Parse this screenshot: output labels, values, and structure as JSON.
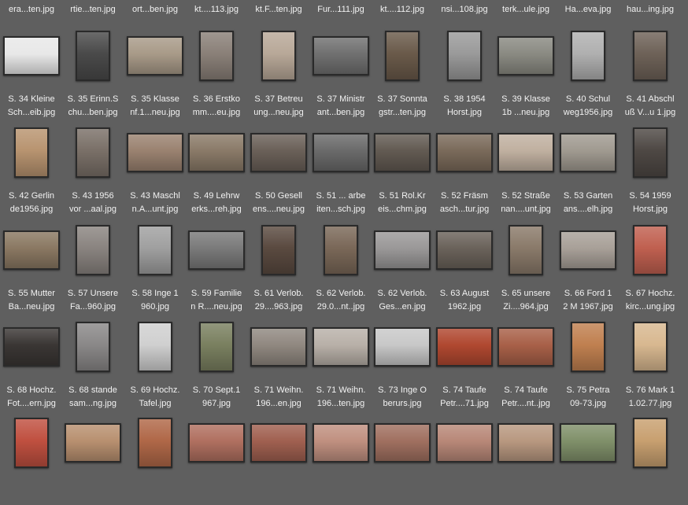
{
  "top_row": [
    "era...ten.jpg",
    "rtie...ten.jpg",
    "ort...ben.jpg",
    "kt....113.jpg",
    "kt.F...ten.jpg",
    "Fur...111.jpg",
    "kt....112.jpg",
    "nsi...108.jpg",
    "terk...ule.jpg",
    "Ha...eva.jpg",
    "hau...ing.jpg"
  ],
  "rows": [
    [
      {
        "l1": "S. 34 Kleine",
        "l2": "Sch...eib.jpg",
        "orient": "l",
        "tone": "#e8e8e8"
      },
      {
        "l1": "S. 35 Erinn.S",
        "l2": "chu...ben.jpg",
        "orient": "p",
        "tone": "#4a4a4a"
      },
      {
        "l1": "S. 35 Klasse",
        "l2": "nf.1...neu.jpg",
        "orient": "l",
        "tone": "#a89a88"
      },
      {
        "l1": "S. 36 Erstko",
        "l2": "mm....eu.jpg",
        "orient": "p",
        "tone": "#8a8078"
      },
      {
        "l1": "S. 37 Betreu",
        "l2": "ung...neu.jpg",
        "orient": "p",
        "tone": "#b8a898"
      },
      {
        "l1": "S. 37 Ministr",
        "l2": "ant...ben.jpg",
        "orient": "l",
        "tone": "#707070"
      },
      {
        "l1": "S. 37 Sonnta",
        "l2": "gstr...ten.jpg",
        "orient": "p",
        "tone": "#6a5a4a"
      },
      {
        "l1": "S. 38 1954",
        "l2": "Horst.jpg",
        "orient": "p",
        "tone": "#9a9a9a"
      },
      {
        "l1": "S. 39 Klasse",
        "l2": "1b ...neu.jpg",
        "orient": "l",
        "tone": "#8a8a82"
      },
      {
        "l1": "S. 40 Schul",
        "l2": "weg1956.jpg",
        "orient": "p",
        "tone": "#b0b0b0"
      },
      {
        "l1": "S. 41 Abschl",
        "l2": "uß V...u 1.jpg",
        "orient": "p",
        "tone": "#6e6258"
      }
    ],
    [
      {
        "l1": "S. 42 Gerlin",
        "l2": "de1956.jpg",
        "orient": "p",
        "tone": "#b89470"
      },
      {
        "l1": "S. 43 1956",
        "l2": "vor ...aal.jpg",
        "orient": "p",
        "tone": "#7a7068"
      },
      {
        "l1": "S. 43 Maschl",
        "l2": "n.A...unt.jpg",
        "orient": "l",
        "tone": "#9a8270"
      },
      {
        "l1": "S. 49 Lehrw",
        "l2": "erks...reh.jpg",
        "orient": "l",
        "tone": "#8a7a68"
      },
      {
        "l1": "S. 50 Gesell",
        "l2": "ens....neu.jpg",
        "orient": "l",
        "tone": "#6a6058"
      },
      {
        "l1": "S. 51 ... arbe",
        "l2": "iten...sch.jpg",
        "orient": "l",
        "tone": "#6a6a6a"
      },
      {
        "l1": "S. 51 Rol.Kr",
        "l2": "eis...chm.jpg",
        "orient": "l",
        "tone": "#625a52"
      },
      {
        "l1": "S. 52 Fräsm",
        "l2": "asch...tur.jpg",
        "orient": "l",
        "tone": "#7a6a5a"
      },
      {
        "l1": "S. 52 Straße",
        "l2": "nan....unt.jpg",
        "orient": "l",
        "tone": "#c0b0a0"
      },
      {
        "l1": "S. 53 Garten",
        "l2": "ans....elh.jpg",
        "orient": "l",
        "tone": "#a09a90"
      },
      {
        "l1": "S. 54 1959",
        "l2": "Horst.jpg",
        "orient": "p",
        "tone": "#4e4844"
      }
    ],
    [
      {
        "l1": "S. 55 Mutter",
        "l2": "Ba...neu.jpg",
        "orient": "l",
        "tone": "#8a7862"
      },
      {
        "l1": "S. 57 Unsere",
        "l2": "Fa...960.jpg",
        "orient": "p",
        "tone": "#8a8480"
      },
      {
        "l1": "S. 58 Inge 1",
        "l2": "960.jpg",
        "orient": "p",
        "tone": "#a0a0a0"
      },
      {
        "l1": "S. 59 Familie",
        "l2": "n R....neu.jpg",
        "orient": "l",
        "tone": "#7a7a7a"
      },
      {
        "l1": "S. 61 Verlob.",
        "l2": "29....963.jpg",
        "orient": "p",
        "tone": "#5a4a40"
      },
      {
        "l1": "S. 62 Verlob.",
        "l2": "29.0...nt..jpg",
        "orient": "p",
        "tone": "#7a6858"
      },
      {
        "l1": "S. 62 Verlob.",
        "l2": "Ges...en.jpg",
        "orient": "l",
        "tone": "#9a9898"
      },
      {
        "l1": "S. 63 August",
        "l2": "1962.jpg",
        "orient": "l",
        "tone": "#6a625a"
      },
      {
        "l1": "S. 65 unsere",
        "l2": "Zi....964.jpg",
        "orient": "p",
        "tone": "#8a7a6a"
      },
      {
        "l1": "S. 66 Ford 1",
        "l2": "2 M 1967.jpg",
        "orient": "l",
        "tone": "#a8a098"
      },
      {
        "l1": "S. 67 Hochz.",
        "l2": "kirc...ung.jpg",
        "orient": "p",
        "tone": "#c06050"
      }
    ],
    [
      {
        "l1": "S. 68 Hochz.",
        "l2": "Fot....ern.jpg",
        "orient": "l",
        "tone": "#3a3634"
      },
      {
        "l1": "S. 68 stande",
        "l2": "sam...ng.jpg",
        "orient": "p",
        "tone": "#8a8888"
      },
      {
        "l1": "S. 69 Hochz.",
        "l2": "Tafel.jpg",
        "orient": "p",
        "tone": "#d0d0d0"
      },
      {
        "l1": "S. 70 Sept.1",
        "l2": "967.jpg",
        "orient": "p",
        "tone": "#7a8060"
      },
      {
        "l1": "S. 71 Weihn.",
        "l2": "196...en.jpg",
        "orient": "l",
        "tone": "#908880"
      },
      {
        "l1": "S. 71 Weihn.",
        "l2": "196...ten.jpg",
        "orient": "l",
        "tone": "#b8b0a8"
      },
      {
        "l1": "S. 73 Inge O",
        "l2": "berurs.jpg",
        "orient": "l",
        "tone": "#c8c8c8"
      },
      {
        "l1": "S. 74 Taufe",
        "l2": "Petr....71.jpg",
        "orient": "l",
        "tone": "#b04830"
      },
      {
        "l1": "S. 74 Taufe",
        "l2": "Petr....nt..jpg",
        "orient": "l",
        "tone": "#a86048"
      },
      {
        "l1": "S. 75 Petra",
        "l2": "09-73.jpg",
        "orient": "p",
        "tone": "#c08050"
      },
      {
        "l1": "S. 76 Mark 1",
        "l2": "1.02.77.jpg",
        "orient": "p",
        "tone": "#d8b890"
      }
    ],
    [
      {
        "orient": "p",
        "tone": "#c05040"
      },
      {
        "orient": "l",
        "tone": "#b89070"
      },
      {
        "orient": "p",
        "tone": "#b06848"
      },
      {
        "orient": "l",
        "tone": "#b07060"
      },
      {
        "orient": "l",
        "tone": "#a06050"
      },
      {
        "orient": "l",
        "tone": "#c09080"
      },
      {
        "orient": "l",
        "tone": "#a07060"
      },
      {
        "orient": "l",
        "tone": "#b88878"
      },
      {
        "orient": "l",
        "tone": "#b89880"
      },
      {
        "orient": "l",
        "tone": "#80906a"
      },
      {
        "orient": "p",
        "tone": "#c8a070"
      }
    ]
  ]
}
